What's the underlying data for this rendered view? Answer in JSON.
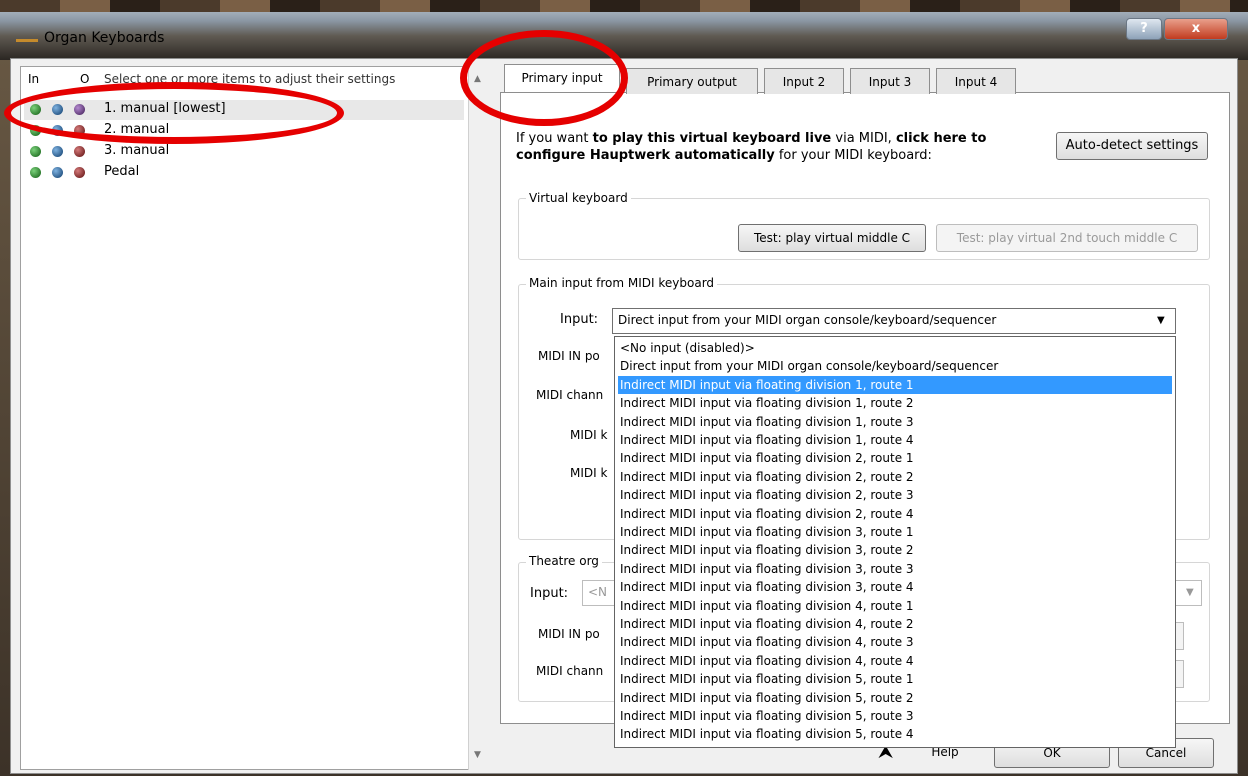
{
  "window": {
    "title": "Organ Keyboards",
    "help_label": "?",
    "close_label": "x"
  },
  "left": {
    "col_in": "In",
    "col_out": "O",
    "hint": "Select one or more items to adjust their settings",
    "items": [
      {
        "label": "1. manual [lowest]"
      },
      {
        "label": "2. manual"
      },
      {
        "label": "3. manual"
      },
      {
        "label": "Pedal"
      }
    ]
  },
  "tabs": [
    "Primary input",
    "Primary output",
    "Input 2",
    "Input 3",
    "Input 4"
  ],
  "autodetect": {
    "text_prefix": "If you want ",
    "text_bold1": "to play this virtual keyboard live",
    "text_mid": " via MIDI, ",
    "text_bold2": "click here to configure Hauptwerk automatically",
    "text_suffix": " for your MIDI keyboard:",
    "button": "Auto-detect settings"
  },
  "virtual_keyboard": {
    "label": "Virtual keyboard",
    "test_button": "Test: play virtual middle C",
    "test_2nd_button": "Test: play virtual 2nd touch middle C"
  },
  "main_input": {
    "label": "Main input from MIDI keyboard",
    "input_label": "Input:",
    "input_value": "Direct input from your MIDI organ console/keyboard/sequencer",
    "partial_labels": [
      "MIDI IN po",
      "MIDI chann",
      "MIDI k",
      "MIDI k"
    ]
  },
  "theatre": {
    "label": "Theatre org",
    "input_label": "Input:",
    "input_partial": "<N",
    "partial_labels": [
      "MIDI IN po",
      "MIDI chann"
    ]
  },
  "dropdown": {
    "selected_index": 2,
    "options": [
      "<No input (disabled)>",
      "Direct input from your MIDI organ console/keyboard/sequencer",
      "Indirect MIDI input via floating division 1, route 1",
      "Indirect MIDI input via floating division 1, route 2",
      "Indirect MIDI input via floating division 1, route 3",
      "Indirect MIDI input via floating division 1, route 4",
      "Indirect MIDI input via floating division 2, route 1",
      "Indirect MIDI input via floating division 2, route 2",
      "Indirect MIDI input via floating division 2, route 3",
      "Indirect MIDI input via floating division 2, route 4",
      "Indirect MIDI input via floating division 3, route 1",
      "Indirect MIDI input via floating division 3, route 2",
      "Indirect MIDI input via floating division 3, route 3",
      "Indirect MIDI input via floating division 3, route 4",
      "Indirect MIDI input via floating division 4, route 1",
      "Indirect MIDI input via floating division 4, route 2",
      "Indirect MIDI input via floating division 4, route 3",
      "Indirect MIDI input via floating division 4, route 4",
      "Indirect MIDI input via floating division 5, route 1",
      "Indirect MIDI input via floating division 5, route 2",
      "Indirect MIDI input via floating division 5, route 3",
      "Indirect MIDI input via floating division 5, route 4"
    ]
  },
  "footer": {
    "help": "Help",
    "ok": "OK",
    "cancel": "Cancel"
  }
}
